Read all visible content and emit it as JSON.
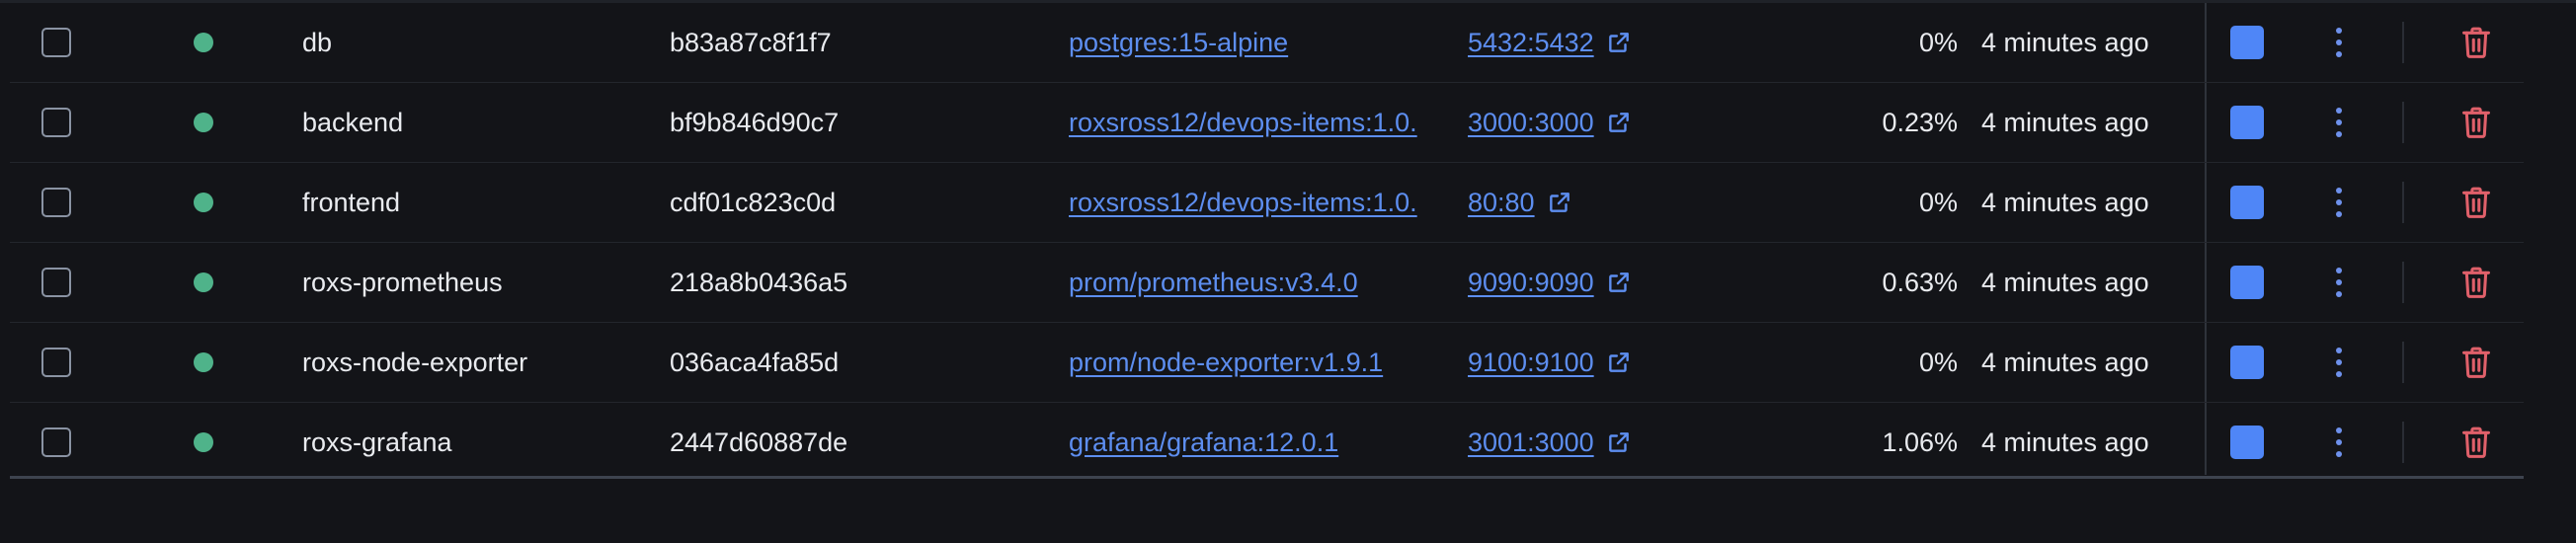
{
  "colors": {
    "background": "#131418",
    "status_running": "#4fb38a",
    "link": "#5d8ef0",
    "stop_button": "#4f86f7",
    "delete_icon": "#e0606a"
  },
  "containers": [
    {
      "name": "db",
      "id": "b83a87c8f1f7",
      "image": "postgres:15-alpine",
      "port": "5432:5432",
      "cpu": "0%",
      "started": "4 minutes ago"
    },
    {
      "name": "backend",
      "id": "bf9b846d90c7",
      "image": "roxsross12/devops-items:1.0.",
      "port": "3000:3000",
      "cpu": "0.23%",
      "started": "4 minutes ago"
    },
    {
      "name": "frontend",
      "id": "cdf01c823c0d",
      "image": "roxsross12/devops-items:1.0.",
      "port": "80:80",
      "cpu": "0%",
      "started": "4 minutes ago"
    },
    {
      "name": "roxs-prometheus",
      "id": "218a8b0436a5",
      "image": "prom/prometheus:v3.4.0",
      "port": "9090:9090",
      "cpu": "0.63%",
      "started": "4 minutes ago"
    },
    {
      "name": "roxs-node-exporter",
      "id": "036aca4fa85d",
      "image": "prom/node-exporter:v1.9.1",
      "port": "9100:9100",
      "cpu": "0%",
      "started": "4 minutes ago"
    },
    {
      "name": "roxs-grafana",
      "id": "2447d60887de",
      "image": "grafana/grafana:12.0.1",
      "port": "3001:3000",
      "cpu": "1.06%",
      "started": "4 minutes ago"
    }
  ],
  "icons": {
    "status": "running-status-dot",
    "external_link": "external-link-icon",
    "stop": "stop-icon",
    "menu": "more-vertical-icon",
    "delete": "trash-icon"
  }
}
